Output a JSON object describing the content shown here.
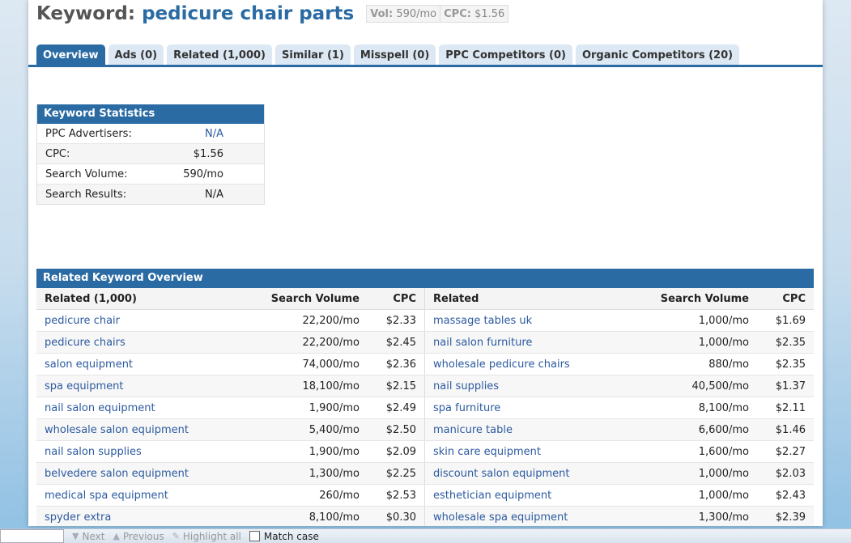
{
  "header": {
    "label": "Keyword:",
    "keyword": "pedicure chair parts",
    "vol_label": "Vol:",
    "vol_value": "590/mo",
    "cpc_label": "CPC:",
    "cpc_value": "$1.56"
  },
  "tabs": [
    {
      "label": "Overview",
      "active": true
    },
    {
      "label": "Ads (0)"
    },
    {
      "label": "Related (1,000)"
    },
    {
      "label": "Similar (1)"
    },
    {
      "label": "Misspell (0)"
    },
    {
      "label": "PPC Competitors (0)"
    },
    {
      "label": "Organic Competitors (20)"
    }
  ],
  "keyword_stats": {
    "title": "Keyword Statistics",
    "rows": [
      {
        "label": "PPC Advertisers:",
        "value": "N/A"
      },
      {
        "label": "CPC:",
        "value": "$1.56"
      },
      {
        "label": "Search Volume:",
        "value": "590/mo"
      },
      {
        "label": "Search Results:",
        "value": "N/A"
      }
    ]
  },
  "related": {
    "title": "Related Keyword Overview",
    "left_headers": [
      "Related (1,000)",
      "Search Volume",
      "CPC"
    ],
    "right_headers": [
      "Related",
      "Search Volume",
      "CPC"
    ],
    "left_rows": [
      [
        "pedicure chair",
        "22,200/mo",
        "$2.33"
      ],
      [
        "pedicure chairs",
        "22,200/mo",
        "$2.45"
      ],
      [
        "salon equipment",
        "74,000/mo",
        "$2.36"
      ],
      [
        "spa equipment",
        "18,100/mo",
        "$2.15"
      ],
      [
        "nail salon equipment",
        "1,900/mo",
        "$2.49"
      ],
      [
        "wholesale salon equipment",
        "5,400/mo",
        "$2.50"
      ],
      [
        "nail salon supplies",
        "1,900/mo",
        "$2.09"
      ],
      [
        "belvedere salon equipment",
        "1,300/mo",
        "$2.25"
      ],
      [
        "medical spa equipment",
        "260/mo",
        "$2.53"
      ],
      [
        "spyder extra",
        "8,100/mo",
        "$0.30"
      ]
    ],
    "right_rows": [
      [
        "massage tables uk",
        "1,000/mo",
        "$1.69"
      ],
      [
        "nail salon furniture",
        "1,000/mo",
        "$2.35"
      ],
      [
        "wholesale pedicure chairs",
        "880/mo",
        "$2.35"
      ],
      [
        "nail supplies",
        "40,500/mo",
        "$1.37"
      ],
      [
        "spa furniture",
        "8,100/mo",
        "$2.11"
      ],
      [
        "manicure table",
        "6,600/mo",
        "$1.46"
      ],
      [
        "skin care equipment",
        "1,600/mo",
        "$2.27"
      ],
      [
        "discount salon equipment",
        "1,000/mo",
        "$2.03"
      ],
      [
        "esthetician equipment",
        "1,000/mo",
        "$2.43"
      ],
      [
        "wholesale spa equipment",
        "1,300/mo",
        "$2.39"
      ]
    ]
  },
  "findbar": {
    "next": "Next",
    "previous": "Previous",
    "highlight": "Highlight all",
    "match_case": "Match case"
  }
}
